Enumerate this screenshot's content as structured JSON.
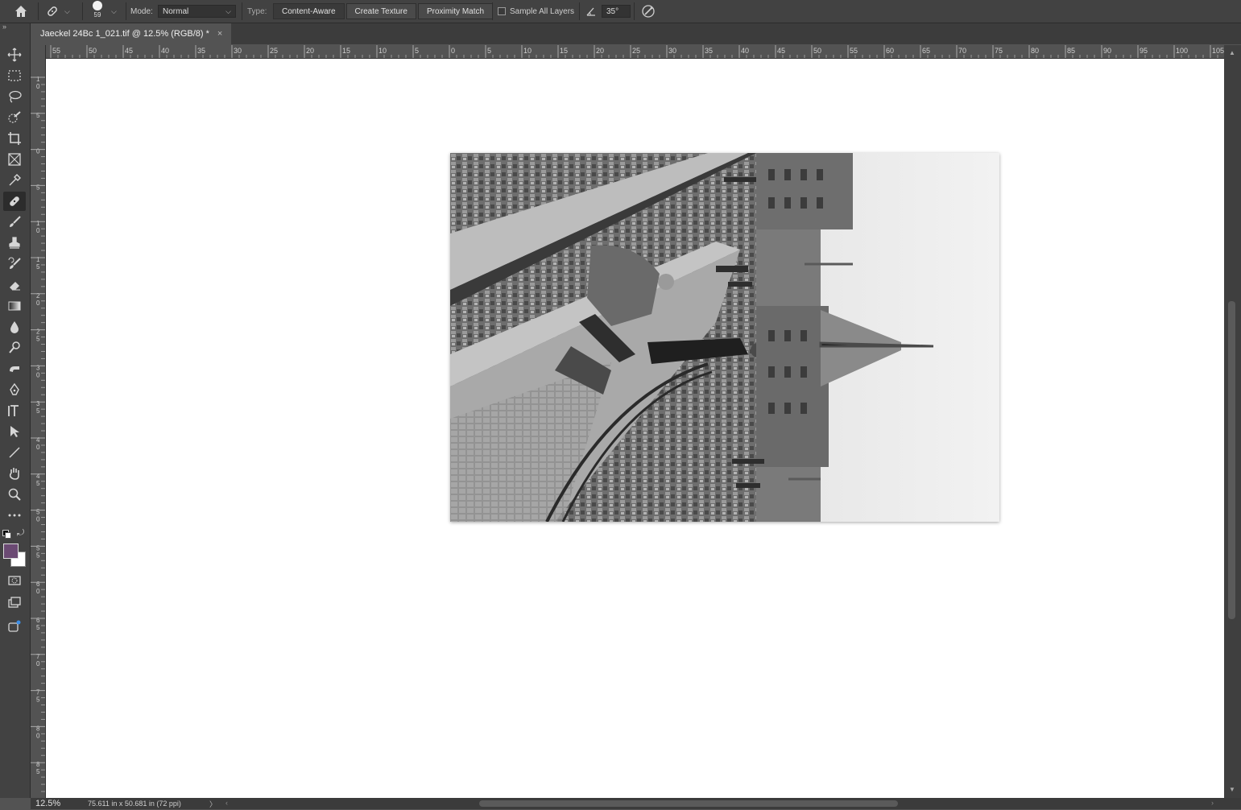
{
  "options_bar": {
    "brush_size": "59",
    "mode_label": "Mode:",
    "mode_value": "Normal",
    "type_label": "Type:",
    "type_buttons": [
      "Content-Aware",
      "Create Texture",
      "Proximity Match"
    ],
    "active_type": "Content-Aware",
    "sample_all_layers_label": "Sample All Layers",
    "sample_all_layers_checked": false,
    "angle_value": "35°"
  },
  "tab": {
    "title": "Jaeckel 24Bc 1_021.tif @ 12.5% (RGB/8) *",
    "close": "×"
  },
  "toolbar": {
    "collapse": "»",
    "tools": [
      "move-tool",
      "marquee-tool",
      "lasso-tool",
      "quick-selection-tool",
      "crop-tool",
      "frame-tool",
      "eyedropper-tool",
      "spot-healing-brush-tool",
      "brush-tool",
      "clone-stamp-tool",
      "history-brush-tool",
      "eraser-tool",
      "gradient-tool",
      "blur-tool",
      "dodge-tool",
      "smudge-tool",
      "pen-tool",
      "type-tool",
      "path-selection-tool",
      "line-tool",
      "hand-tool",
      "zoom-tool",
      "edit-toolbar"
    ],
    "selected_tool": "spot-healing-brush-tool",
    "foreground_color": "#6b4a73",
    "background_color": "#ffffff"
  },
  "ruler": {
    "h_labels": [
      "55",
      "50",
      "45",
      "40",
      "35",
      "30",
      "25",
      "20",
      "15",
      "10",
      "5",
      "0",
      "5",
      "10",
      "15",
      "20",
      "25",
      "30",
      "35",
      "40",
      "45",
      "50",
      "55",
      "60",
      "65",
      "70",
      "75",
      "80",
      "85",
      "90",
      "95",
      "100",
      "105"
    ],
    "v_labels": [
      "1 0",
      "5",
      "0",
      "5",
      "1 0",
      "1 5",
      "2 0",
      "2 5",
      "3 0",
      "3 5",
      "4 0",
      "4 5",
      "5 0",
      "5 5",
      "6 0",
      "6 5",
      "7 0",
      "7 5",
      "8 0",
      "8 5"
    ]
  },
  "status": {
    "zoom": "12.5%",
    "doc_info": "75.611 in x 50.681 in (72 ppi)",
    "arrow": "〉"
  }
}
